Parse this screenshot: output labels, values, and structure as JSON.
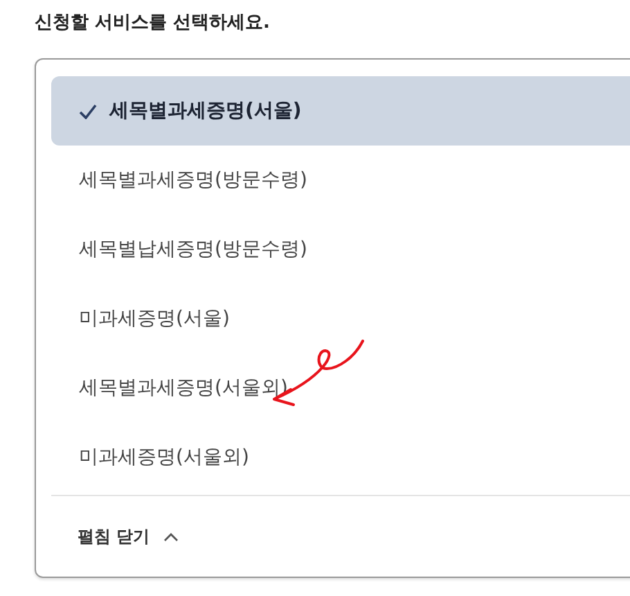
{
  "prompt": "신청할 서비스를 선택하세요.",
  "options": [
    {
      "label": "세목별과세증명(서울)",
      "selected": true
    },
    {
      "label": "세목별과세증명(방문수령)",
      "selected": false
    },
    {
      "label": "세목별납세증명(방문수령)",
      "selected": false
    },
    {
      "label": "미과세증명(서울)",
      "selected": false
    },
    {
      "label": "세목별과세증명(서울외)",
      "selected": false
    },
    {
      "label": "미과세증명(서울외)",
      "selected": false
    }
  ],
  "collapse_button": {
    "label": "펼침 닫기"
  }
}
